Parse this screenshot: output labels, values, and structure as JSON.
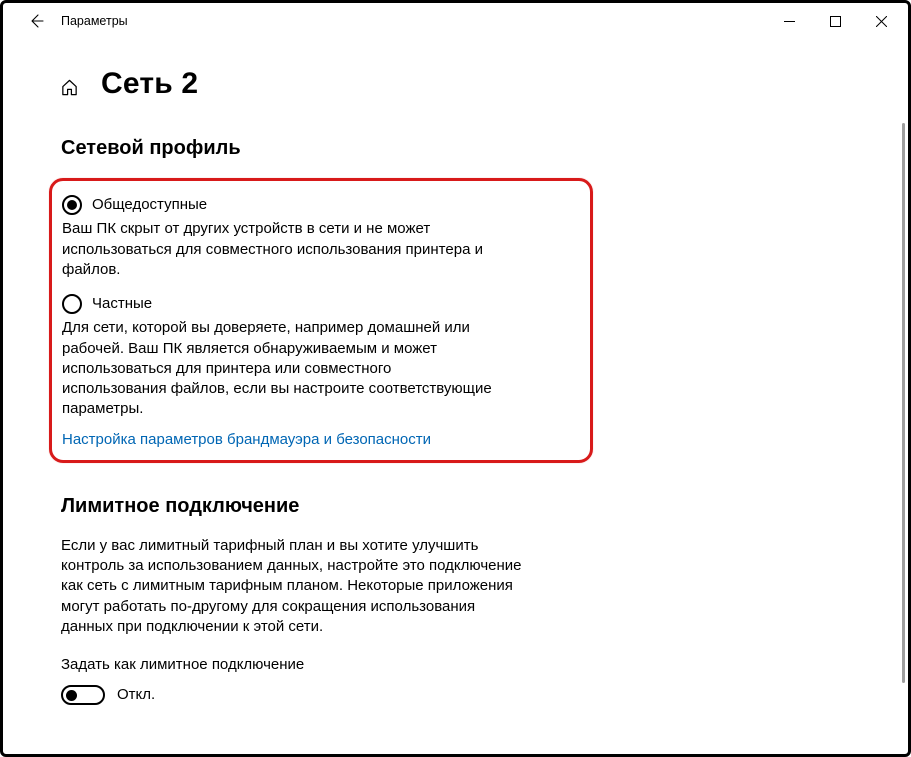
{
  "titlebar": {
    "app_title": "Параметры"
  },
  "page": {
    "title": "Сеть 2"
  },
  "network_profile": {
    "heading": "Сетевой профиль",
    "public": {
      "label": "Общедоступные",
      "desc": "Ваш ПК скрыт от других устройств в сети и не может использоваться для совместного использования принтера и файлов.",
      "selected": true
    },
    "private": {
      "label": "Частные",
      "desc": "Для сети, которой вы доверяете, например домашней или рабочей. Ваш ПК является обнаруживаемым и может использоваться для принтера или совместного использования файлов, если вы настроите соответствующие параметры.",
      "selected": false
    },
    "firewall_link": "Настройка параметров брандмауэра и безопасности"
  },
  "metered": {
    "heading": "Лимитное подключение",
    "desc": "Если у вас лимитный тарифный план и вы хотите улучшить контроль за использованием данных, настройте это подключение как сеть с лимитным тарифным планом. Некоторые приложения могут работать по-другому для сокращения использования данных при подключении к этой сети.",
    "toggle_label": "Задать как лимитное подключение",
    "toggle_state": "Откл.",
    "toggle_on": false
  }
}
